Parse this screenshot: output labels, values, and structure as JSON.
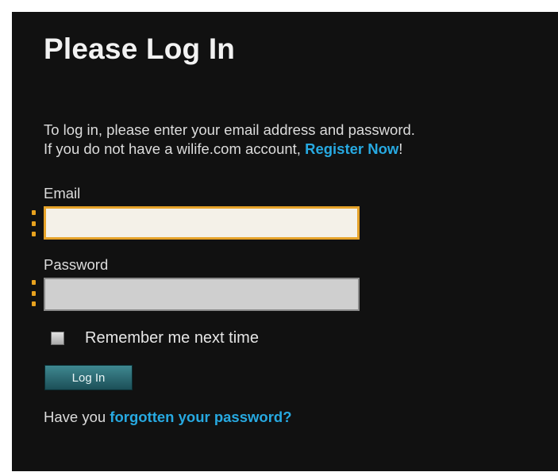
{
  "title": "Please Log In",
  "intro": {
    "line1": "To log in, please enter your email address and password.",
    "line2_before": "If you do not have a wilife.com account, ",
    "register_link": "Register Now",
    "line2_after": "!"
  },
  "email": {
    "label": "Email",
    "value": ""
  },
  "password": {
    "label": "Password",
    "value": ""
  },
  "remember": {
    "label": "Remember me next time",
    "checked": false
  },
  "login_button": "Log In",
  "forgot": {
    "prefix": "Have you ",
    "link": "forgotten your password?"
  },
  "colors": {
    "background": "#111111",
    "link": "#27a9e1",
    "required_marker": "#e8a21e",
    "email_border": "#e6a32a"
  }
}
